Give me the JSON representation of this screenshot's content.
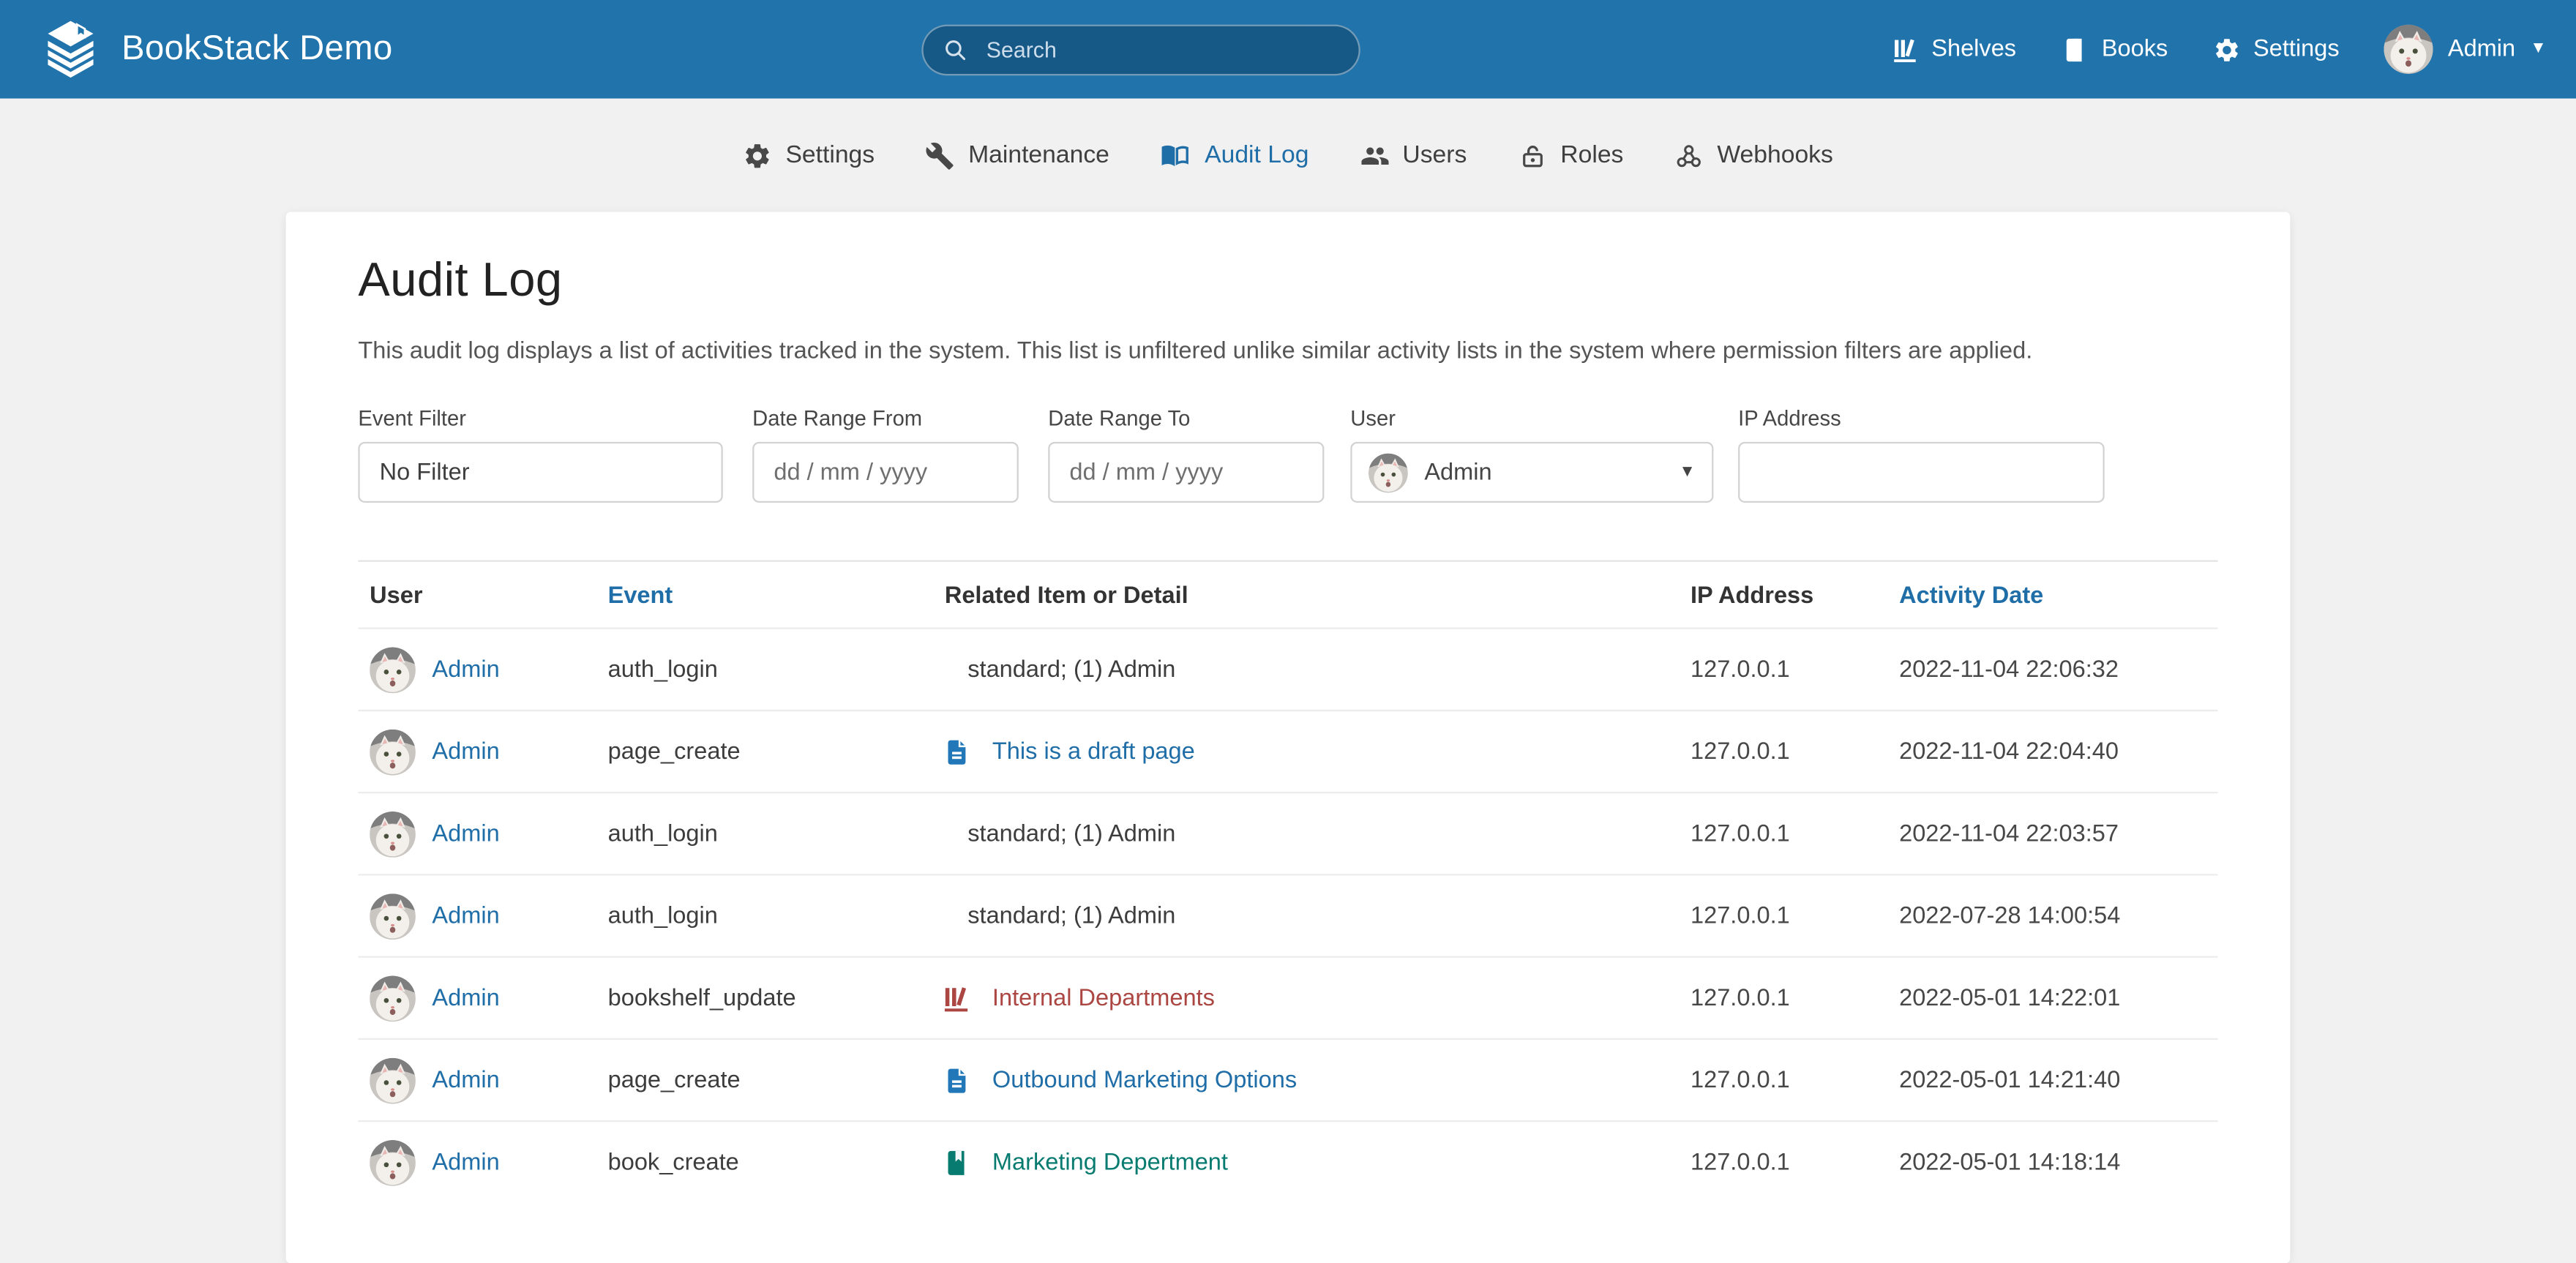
{
  "header": {
    "logo_title": "BookStack Demo",
    "search": {
      "placeholder": "Search"
    },
    "nav": {
      "shelves": "Shelves",
      "books": "Books",
      "settings": "Settings"
    },
    "user": {
      "name": "Admin"
    }
  },
  "settings_nav": {
    "items": [
      {
        "label": "Settings",
        "icon": "gear-icon",
        "active": false
      },
      {
        "label": "Maintenance",
        "icon": "wrench-icon",
        "active": false
      },
      {
        "label": "Audit Log",
        "icon": "open-book-icon",
        "active": true
      },
      {
        "label": "Users",
        "icon": "users-icon",
        "active": false
      },
      {
        "label": "Roles",
        "icon": "lock-icon",
        "active": false
      },
      {
        "label": "Webhooks",
        "icon": "webhook-icon",
        "active": false
      }
    ]
  },
  "page": {
    "title": "Audit Log",
    "description": "This audit log displays a list of activities tracked in the system. This list is unfiltered unlike similar activity lists in the system where permission filters are applied."
  },
  "filters": {
    "event": {
      "label": "Event Filter",
      "value": "No Filter"
    },
    "date_from": {
      "label": "Date Range From",
      "placeholder": "dd / mm / yyyy"
    },
    "date_to": {
      "label": "Date Range To",
      "placeholder": "dd / mm / yyyy"
    },
    "user": {
      "label": "User",
      "value": "Admin"
    },
    "ip": {
      "label": "IP Address",
      "value": ""
    }
  },
  "table": {
    "columns": [
      {
        "label": "User",
        "sortable": false
      },
      {
        "label": "Event",
        "sortable": true
      },
      {
        "label": "Related Item or Detail",
        "sortable": false
      },
      {
        "label": "IP Address",
        "sortable": false
      },
      {
        "label": "Activity Date",
        "sortable": true
      }
    ],
    "rows": [
      {
        "user": "Admin",
        "event": "auth_login",
        "detail": "standard; (1) Admin",
        "detail_type": "text",
        "ip": "127.0.0.1",
        "date": "2022-11-04 22:06:32"
      },
      {
        "user": "Admin",
        "event": "page_create",
        "detail": "This is a draft page",
        "detail_type": "page",
        "ip": "127.0.0.1",
        "date": "2022-11-04 22:04:40"
      },
      {
        "user": "Admin",
        "event": "auth_login",
        "detail": "standard; (1) Admin",
        "detail_type": "text",
        "ip": "127.0.0.1",
        "date": "2022-11-04 22:03:57"
      },
      {
        "user": "Admin",
        "event": "auth_login",
        "detail": "standard; (1) Admin",
        "detail_type": "text",
        "ip": "127.0.0.1",
        "date": "2022-07-28 14:00:54"
      },
      {
        "user": "Admin",
        "event": "bookshelf_update",
        "detail": "Internal Departments",
        "detail_type": "shelf",
        "ip": "127.0.0.1",
        "date": "2022-05-01 14:22:01"
      },
      {
        "user": "Admin",
        "event": "page_create",
        "detail": "Outbound Marketing Options",
        "detail_type": "page",
        "ip": "127.0.0.1",
        "date": "2022-05-01 14:21:40"
      },
      {
        "user": "Admin",
        "event": "book_create",
        "detail": "Marketing Depertment",
        "detail_type": "book",
        "ip": "127.0.0.1",
        "date": "2022-05-01 14:18:14"
      }
    ]
  },
  "colors": {
    "header_bg": "#2173ac",
    "link_blue": "#206ea7",
    "entity_page": "#206ea7",
    "entity_shelf": "#ab4642",
    "entity_book": "#077b70",
    "page_bg": "#f1f1f1"
  }
}
